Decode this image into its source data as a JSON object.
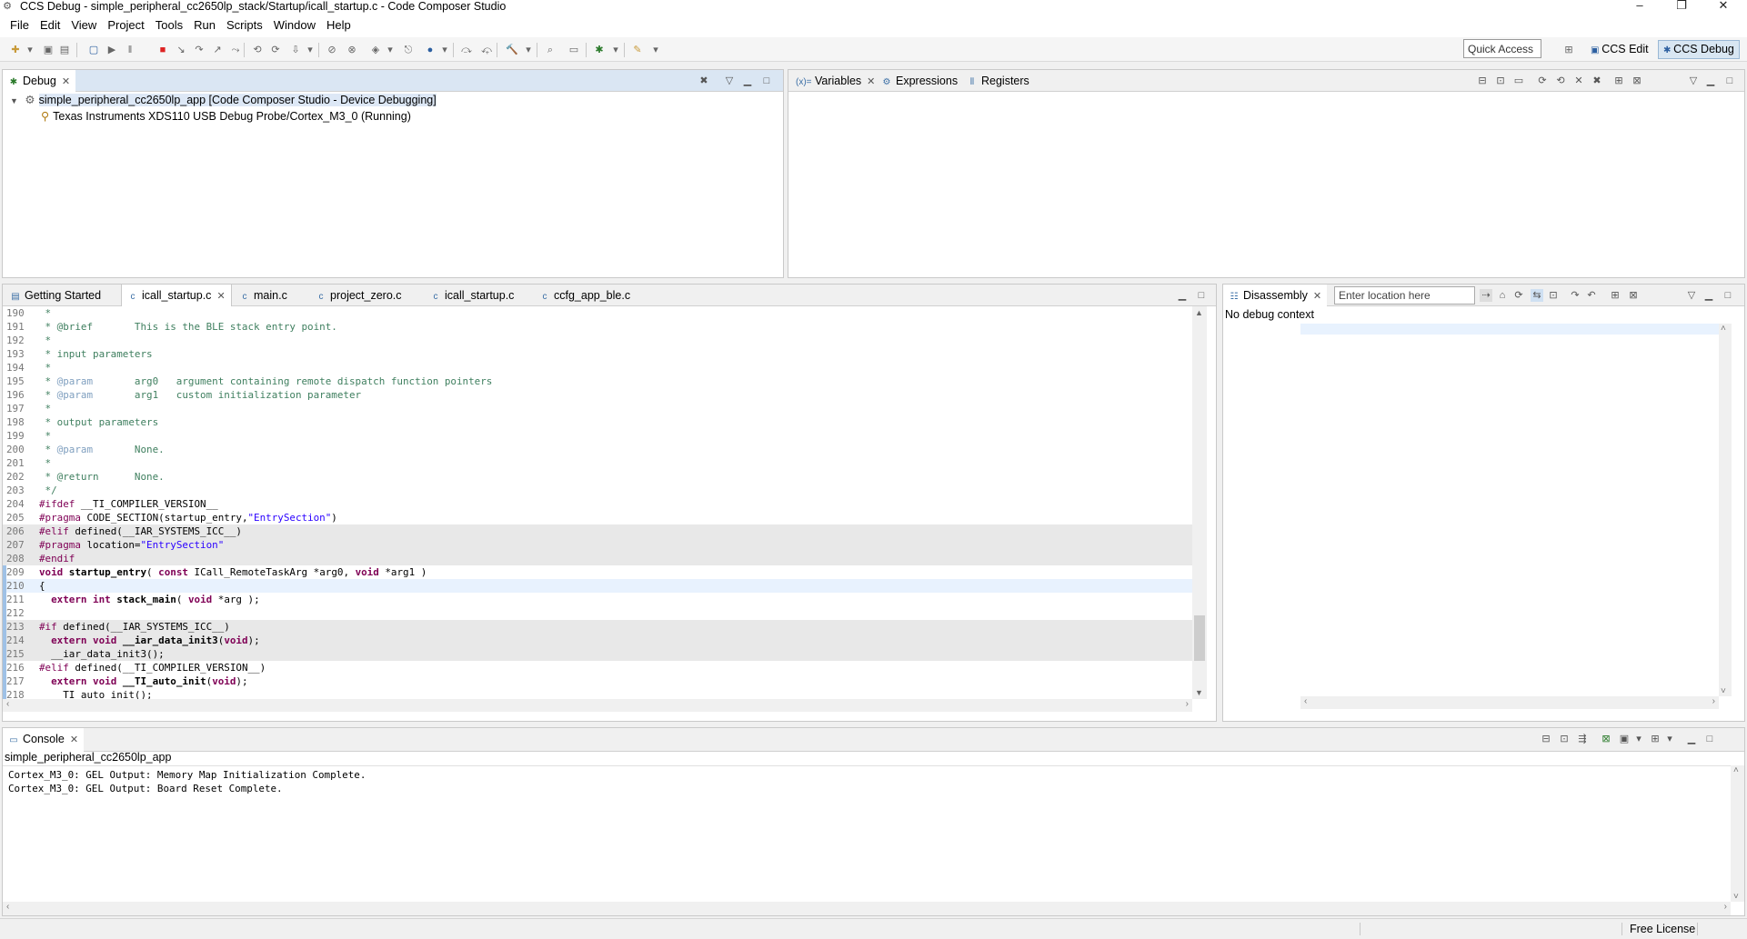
{
  "window": {
    "title": "CCS Debug - simple_peripheral_cc2650lp_stack/Startup/icall_startup.c - Code Composer Studio",
    "minimize": "–",
    "restore": "❐",
    "close": "✕"
  },
  "menubar": [
    "File",
    "Edit",
    "View",
    "Project",
    "Tools",
    "Run",
    "Scripts",
    "Window",
    "Help"
  ],
  "toolbar": {
    "quick_access_placeholder": "Quick Access",
    "perspectives": [
      {
        "label": "CCS Edit",
        "active": false
      },
      {
        "label": "CCS Debug",
        "active": true
      }
    ]
  },
  "debug_view": {
    "tab_label": "Debug",
    "items": [
      {
        "label": "simple_peripheral_cc2650lp_app [Code Composer Studio - Device Debugging]",
        "icon": "debug-session-icon"
      },
      {
        "label": "Texas Instruments XDS110 USB Debug Probe/Cortex_M3_0 (Running)",
        "icon": "thread-running-icon"
      }
    ]
  },
  "variables_view": {
    "tabs": [
      {
        "label": "Variables",
        "icon": "(x)="
      },
      {
        "label": "Expressions",
        "icon": "expressions-icon"
      },
      {
        "label": "Registers",
        "icon": "registers-icon"
      }
    ]
  },
  "editor": {
    "tabs": [
      {
        "label": "Getting Started",
        "active": false
      },
      {
        "label": "icall_startup.c",
        "active": true
      },
      {
        "label": "main.c",
        "active": false
      },
      {
        "label": "project_zero.c",
        "active": false
      },
      {
        "label": "icall_startup.c",
        "active": false
      },
      {
        "label": "ccfg_app_ble.c",
        "active": false
      }
    ],
    "lines": [
      {
        "n": "190",
        "segs": [
          {
            "t": " *",
            "c": "cm"
          }
        ]
      },
      {
        "n": "191",
        "segs": [
          {
            "t": " * @brief       This is the BLE stack entry point.",
            "c": "cm"
          }
        ]
      },
      {
        "n": "192",
        "segs": [
          {
            "t": " *",
            "c": "cm"
          }
        ]
      },
      {
        "n": "193",
        "segs": [
          {
            "t": " * input parameters",
            "c": "cm"
          }
        ]
      },
      {
        "n": "194",
        "segs": [
          {
            "t": " *",
            "c": "cm"
          }
        ]
      },
      {
        "n": "195",
        "segs": [
          {
            "t": " * ",
            "c": "cm"
          },
          {
            "t": "@param",
            "c": "tag"
          },
          {
            "t": "       arg0   argument containing remote dispatch function pointers",
            "c": "cm"
          }
        ]
      },
      {
        "n": "196",
        "segs": [
          {
            "t": " * ",
            "c": "cm"
          },
          {
            "t": "@param",
            "c": "tag"
          },
          {
            "t": "       arg1   custom initialization parameter",
            "c": "cm"
          }
        ]
      },
      {
        "n": "197",
        "segs": [
          {
            "t": " *",
            "c": "cm"
          }
        ]
      },
      {
        "n": "198",
        "segs": [
          {
            "t": " * output parameters",
            "c": "cm"
          }
        ]
      },
      {
        "n": "199",
        "segs": [
          {
            "t": " *",
            "c": "cm"
          }
        ]
      },
      {
        "n": "200",
        "segs": [
          {
            "t": " * ",
            "c": "cm"
          },
          {
            "t": "@param",
            "c": "tag"
          },
          {
            "t": "       None.",
            "c": "cm"
          }
        ]
      },
      {
        "n": "201",
        "segs": [
          {
            "t": " *",
            "c": "cm"
          }
        ]
      },
      {
        "n": "202",
        "segs": [
          {
            "t": " * @return      None.",
            "c": "cm"
          }
        ]
      },
      {
        "n": "203",
        "segs": [
          {
            "t": " */",
            "c": "cm"
          }
        ]
      },
      {
        "n": "204",
        "segs": [
          {
            "t": "#ifdef",
            "c": "mc"
          },
          {
            "t": " __TI_COMPILER_VERSION__",
            "c": ""
          }
        ]
      },
      {
        "n": "205",
        "segs": [
          {
            "t": "#pragma",
            "c": "mc"
          },
          {
            "t": " CODE_SECTION(startup_entry,",
            "c": ""
          },
          {
            "t": "\"EntrySection\"",
            "c": "st"
          },
          {
            "t": ")",
            "c": ""
          }
        ]
      },
      {
        "n": "206",
        "segs": [
          {
            "t": "#elif",
            "c": "mc"
          },
          {
            "t": " defined(__IAR_SYSTEMS_ICC__)",
            "c": ""
          }
        ],
        "inactive": true
      },
      {
        "n": "207",
        "segs": [
          {
            "t": "#pragma",
            "c": "mc"
          },
          {
            "t": " location=",
            "c": ""
          },
          {
            "t": "\"EntrySection\"",
            "c": "st"
          }
        ],
        "inactive": true
      },
      {
        "n": "208",
        "segs": [
          {
            "t": "#endif",
            "c": "mc"
          }
        ],
        "inactive": true
      },
      {
        "n": "209",
        "segs": [
          {
            "t": "void",
            "c": "kw"
          },
          {
            "t": " ",
            "c": ""
          },
          {
            "t": "startup_entry",
            "c": "fn"
          },
          {
            "t": "( ",
            "c": ""
          },
          {
            "t": "const",
            "c": "kw"
          },
          {
            "t": " ICall_RemoteTaskArg *arg0, ",
            "c": ""
          },
          {
            "t": "void",
            "c": "kw"
          },
          {
            "t": " *arg1 )",
            "c": ""
          }
        ]
      },
      {
        "n": "210",
        "segs": [
          {
            "t": "{",
            "c": ""
          }
        ],
        "current": true
      },
      {
        "n": "211",
        "segs": [
          {
            "t": "  ",
            "c": ""
          },
          {
            "t": "extern",
            "c": "kw"
          },
          {
            "t": " ",
            "c": ""
          },
          {
            "t": "int",
            "c": "kw"
          },
          {
            "t": " ",
            "c": ""
          },
          {
            "t": "stack_main",
            "c": "fn"
          },
          {
            "t": "( ",
            "c": ""
          },
          {
            "t": "void",
            "c": "kw"
          },
          {
            "t": " *arg );",
            "c": ""
          }
        ]
      },
      {
        "n": "212",
        "segs": [
          {
            "t": "",
            "c": ""
          }
        ]
      },
      {
        "n": "213",
        "segs": [
          {
            "t": "#if",
            "c": "mc"
          },
          {
            "t": " defined(__IAR_SYSTEMS_ICC__)",
            "c": ""
          }
        ],
        "inactive": true
      },
      {
        "n": "214",
        "segs": [
          {
            "t": "  ",
            "c": ""
          },
          {
            "t": "extern",
            "c": "kw"
          },
          {
            "t": " ",
            "c": ""
          },
          {
            "t": "void",
            "c": "kw"
          },
          {
            "t": " ",
            "c": ""
          },
          {
            "t": "__iar_data_init3",
            "c": "fn"
          },
          {
            "t": "(",
            "c": ""
          },
          {
            "t": "void",
            "c": "kw"
          },
          {
            "t": ");",
            "c": ""
          }
        ],
        "inactive": true
      },
      {
        "n": "215",
        "segs": [
          {
            "t": "  __iar_data_init3();",
            "c": ""
          }
        ],
        "inactive": true
      },
      {
        "n": "216",
        "segs": [
          {
            "t": "#elif",
            "c": "mc"
          },
          {
            "t": " defined(__TI_COMPILER_VERSION__)",
            "c": ""
          }
        ]
      },
      {
        "n": "217",
        "segs": [
          {
            "t": "  ",
            "c": ""
          },
          {
            "t": "extern",
            "c": "kw"
          },
          {
            "t": " ",
            "c": ""
          },
          {
            "t": "void",
            "c": "kw"
          },
          {
            "t": " ",
            "c": ""
          },
          {
            "t": "__TI_auto_init",
            "c": "fn"
          },
          {
            "t": "(",
            "c": ""
          },
          {
            "t": "void",
            "c": "kw"
          },
          {
            "t": ");",
            "c": ""
          }
        ]
      },
      {
        "n": "218",
        "segs": [
          {
            "t": "  __TI_auto_init();",
            "c": ""
          }
        ]
      }
    ]
  },
  "disassembly": {
    "tab_label": "Disassembly",
    "location_placeholder": "Enter location here",
    "status": "No debug context"
  },
  "console": {
    "tab_label": "Console",
    "process": "simple_peripheral_cc2650lp_app",
    "lines": [
      "Cortex_M3_0: GEL Output: Memory Map Initialization Complete.",
      "Cortex_M3_0: GEL Output: Board Reset Complete."
    ]
  },
  "statusbar": {
    "license": "Free License"
  },
  "colors": {
    "inactive_code_bg": "#e8e8e8",
    "current_line_bg": "#e8f2fe",
    "active_view_header": "#dae6f3",
    "perspective_active": "#d8e6f2"
  }
}
